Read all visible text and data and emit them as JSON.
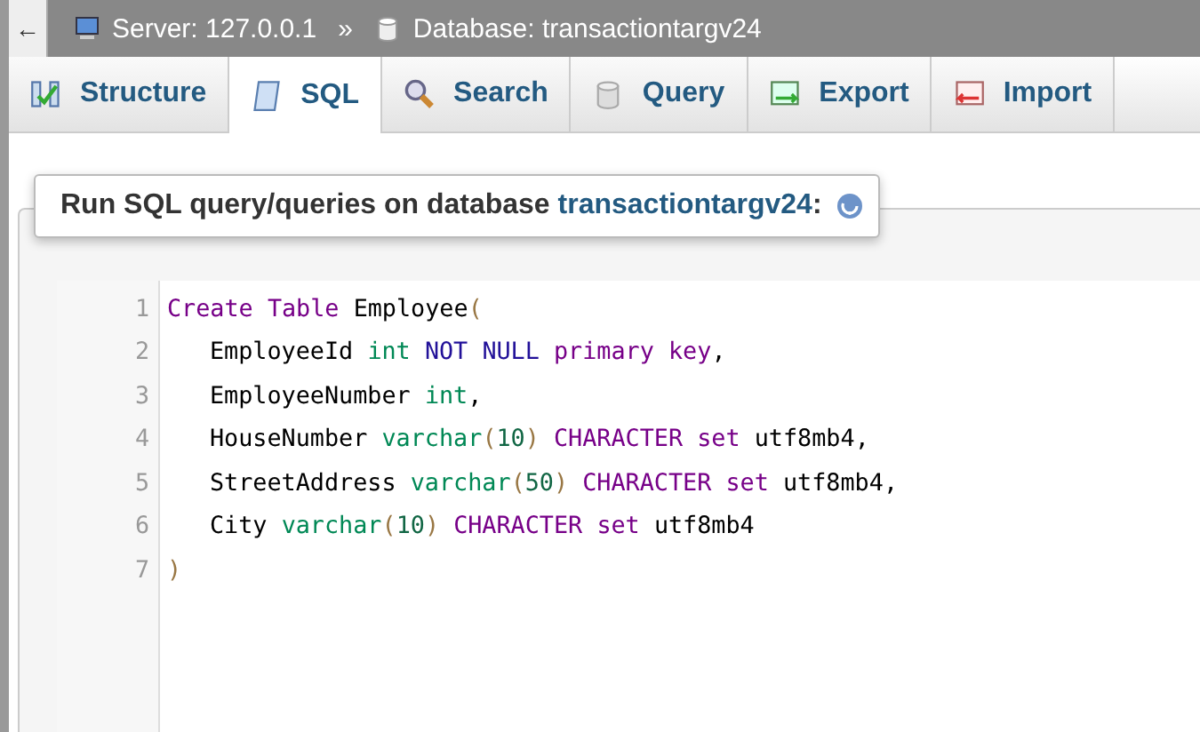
{
  "breadcrumb": {
    "back": "←",
    "items": [
      {
        "kind": "server",
        "label": "Server: 127.0.0.1"
      },
      {
        "kind": "database",
        "label": "Database: transactiontargv24"
      }
    ],
    "separator": "»"
  },
  "tabs": [
    {
      "kind": "structure",
      "label": "Structure",
      "selected": false
    },
    {
      "kind": "sql",
      "label": "SQL",
      "selected": true
    },
    {
      "kind": "search",
      "label": "Search",
      "selected": false
    },
    {
      "kind": "query",
      "label": "Query",
      "selected": false
    },
    {
      "kind": "export",
      "label": "Export",
      "selected": false
    },
    {
      "kind": "import",
      "label": "Import",
      "selected": false
    }
  ],
  "panel": {
    "title": "Run SQL query/queries on database **transactiontargv24**:"
  },
  "editor": {
    "lines": [
      {
        "number": "1",
        "indent": false,
        "tokens": [
          {
            "kind": "keyword",
            "text": "Create"
          },
          {
            "kind": "keyword",
            "text": "Table"
          },
          {
            "kind": "plain",
            "text": "Employee"
          },
          {
            "kind": "bracket",
            "text": "("
          }
        ]
      },
      {
        "number": "2",
        "indent": true,
        "tokens": [
          {
            "kind": "plain",
            "text": "EmployeeId"
          },
          {
            "kind": "type",
            "text": "int"
          },
          {
            "kind": "atom",
            "text": "NOT"
          },
          {
            "kind": "atom",
            "text": "NULL"
          },
          {
            "kind": "keyword",
            "text": "primary"
          },
          {
            "kind": "keyword",
            "text": "key"
          },
          {
            "kind": "plain",
            "text": ","
          }
        ]
      },
      {
        "number": "3",
        "indent": true,
        "tokens": [
          {
            "kind": "plain",
            "text": "EmployeeNumber"
          },
          {
            "kind": "type",
            "text": "int"
          },
          {
            "kind": "plain",
            "text": ","
          }
        ]
      },
      {
        "number": "4",
        "indent": true,
        "tokens": [
          {
            "kind": "plain",
            "text": "HouseNumber"
          },
          {
            "kind": "type",
            "text": "varchar"
          },
          {
            "kind": "bracket",
            "text": "("
          },
          {
            "kind": "number",
            "text": "10"
          },
          {
            "kind": "bracket",
            "text": ")"
          },
          {
            "kind": "keyword",
            "text": "CHARACTER"
          },
          {
            "kind": "keyword",
            "text": "set"
          },
          {
            "kind": "plain",
            "text": "utf8mb4"
          },
          {
            "kind": "plain",
            "text": ","
          }
        ]
      },
      {
        "number": "5",
        "indent": true,
        "tokens": [
          {
            "kind": "plain",
            "text": "StreetAddress"
          },
          {
            "kind": "type",
            "text": "varchar"
          },
          {
            "kind": "bracket",
            "text": "("
          },
          {
            "kind": "number",
            "text": "50"
          },
          {
            "kind": "bracket",
            "text": ")"
          },
          {
            "kind": "keyword",
            "text": "CHARACTER"
          },
          {
            "kind": "keyword",
            "text": "set"
          },
          {
            "kind": "plain",
            "text": "utf8mb4"
          },
          {
            "kind": "plain",
            "text": ","
          }
        ]
      },
      {
        "number": "6",
        "indent": true,
        "tokens": [
          {
            "kind": "plain",
            "text": "City"
          },
          {
            "kind": "type",
            "text": "varchar"
          },
          {
            "kind": "bracket",
            "text": "("
          },
          {
            "kind": "number",
            "text": "10"
          },
          {
            "kind": "bracket",
            "text": ")"
          },
          {
            "kind": "keyword",
            "text": "CHARACTER"
          },
          {
            "kind": "keyword",
            "text": "set"
          },
          {
            "kind": "plain",
            "text": "utf8mb4"
          }
        ]
      },
      {
        "number": "7",
        "indent": false,
        "tokens": [
          {
            "kind": "bracket",
            "text": ")"
          }
        ]
      }
    ]
  }
}
